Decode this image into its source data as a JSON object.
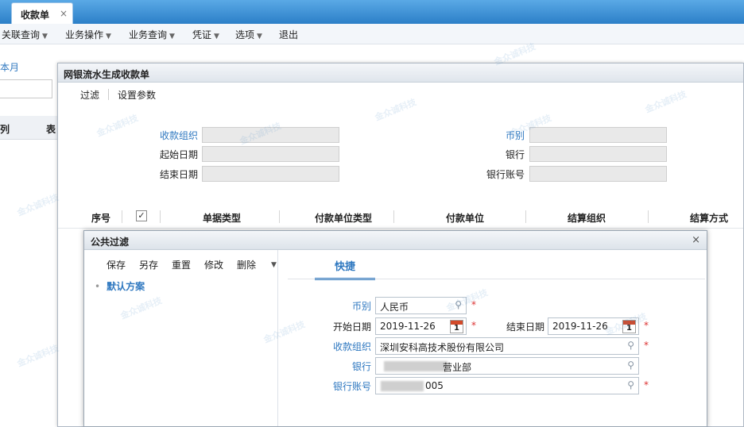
{
  "tab": {
    "title": "收款单",
    "close": "×"
  },
  "menu": [
    {
      "label": "关联查询",
      "caret": "▼"
    },
    {
      "label": "业务操作",
      "caret": "▼"
    },
    {
      "label": "业务查询",
      "caret": "▼"
    },
    {
      "label": "凭证",
      "caret": "▼"
    },
    {
      "label": "选项",
      "caret": "▼"
    },
    {
      "label": "退出",
      "caret": ""
    }
  ],
  "left_panel": {
    "month_label": "本月",
    "col_a": "列",
    "col_b": "表"
  },
  "watermark": "金众诚科技",
  "outer": {
    "title": "网银流水生成收款单",
    "toolbar": {
      "filter": "过滤",
      "settings": "设置参数"
    },
    "form": {
      "org_label": "收款组织",
      "start_label": "起始日期",
      "end_label": "结束日期",
      "currency_label": "币别",
      "bank_label": "银行",
      "account_label": "银行账号"
    },
    "grid_headers": [
      "序号",
      "单据类型",
      "付款单位类型",
      "付款单位",
      "结算组织",
      "结算方式"
    ],
    "check_mark": "✓"
  },
  "dialog": {
    "title": "公共过滤",
    "close": "×",
    "toolbar": [
      "保存",
      "另存",
      "重置",
      "修改",
      "删除"
    ],
    "more": "▼",
    "scheme_bullet": "•",
    "scheme": "默认方案",
    "quick_tab": "快捷",
    "fields": {
      "currency_label": "币别",
      "currency_value": "人民币",
      "start_label": "开始日期",
      "start_value": "2019-11-26",
      "end_label": "结束日期",
      "end_value": "2019-11-26",
      "org_label": "收款组织",
      "org_value": "深圳安科高技术股份有限公司",
      "bank_label": "银行",
      "bank_value": "营业部",
      "account_label": "银行账号",
      "account_value": "005"
    },
    "required_mark": "*",
    "calendar_day": "1",
    "search_icon": "🔍"
  }
}
